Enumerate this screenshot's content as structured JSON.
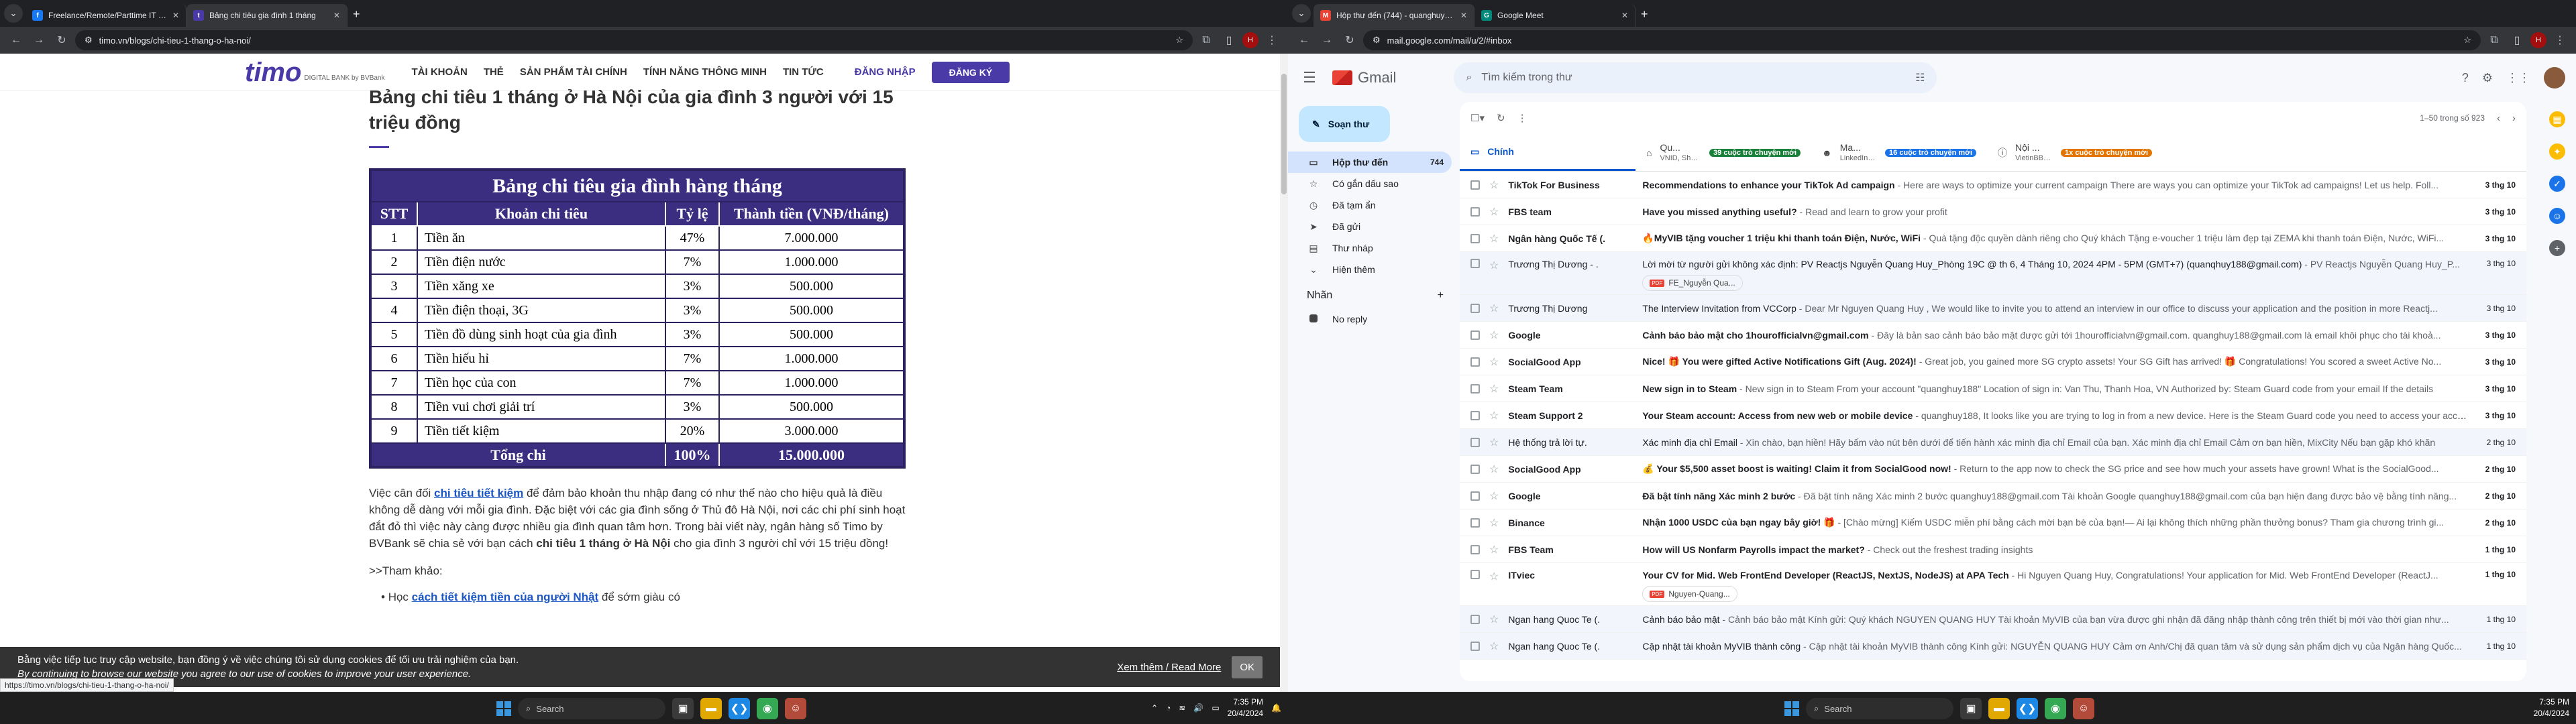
{
  "left": {
    "tabs": [
      {
        "title": "Freelance/Remote/Parttime IT Jobs",
        "favicon": "f"
      },
      {
        "title": "Bảng chi tiêu gia đình 1 tháng",
        "favicon": "t"
      }
    ],
    "url": "timo.vn/blogs/chi-tieu-1-thang-o-ha-noi/",
    "nav": {
      "brand": "timo",
      "brand_sub": "DIGITAL BANK by BVBank",
      "items": [
        "TÀI KHOẢN",
        "THẺ",
        "SẢN PHẨM TÀI CHÍNH",
        "TÍNH NĂNG THÔNG MINH",
        "TIN TỨC"
      ],
      "login": "ĐĂNG NHẬP",
      "signup": "ĐĂNG KÝ"
    },
    "article": {
      "title": "Bảng chi tiêu 1 tháng ở Hà Nội của gia đình 3 người với 15 triệu đồng",
      "table": {
        "caption": "Bảng chi tiêu gia đình hàng tháng",
        "headers": [
          "STT",
          "Khoản chi tiêu",
          "Tỷ lệ",
          "Thành tiền (VNĐ/tháng)"
        ],
        "rows": [
          [
            "1",
            "Tiền ăn",
            "47%",
            "7.000.000"
          ],
          [
            "2",
            "Tiền điện nước",
            "7%",
            "1.000.000"
          ],
          [
            "3",
            "Tiền xăng xe",
            "3%",
            "500.000"
          ],
          [
            "4",
            "Tiền điện thoại, 3G",
            "3%",
            "500.000"
          ],
          [
            "5",
            "Tiền đồ dùng sinh hoạt của gia đình",
            "3%",
            "500.000"
          ],
          [
            "6",
            "Tiền hiếu hỉ",
            "7%",
            "1.000.000"
          ],
          [
            "7",
            "Tiền học của con",
            "7%",
            "1.000.000"
          ],
          [
            "8",
            "Tiền vui chơi giải trí",
            "3%",
            "500.000"
          ],
          [
            "9",
            "Tiền tiết kiệm",
            "20%",
            "3.000.000"
          ]
        ],
        "total_label": "Tổng chi",
        "total_ratio": "100%",
        "total_amount": "15.000.000"
      },
      "p1_before": "Việc cân đối ",
      "p1_link": "chi tiêu tiết kiệm",
      "p1_mid": " để đảm bảo khoản thu nhập đang có như thế nào cho hiệu quả là điều không dễ dàng với mỗi gia đình. Đặc biệt với các gia đình sống ở Thủ đô Hà Nội, nơi các chi phí sinh hoạt đắt đỏ thì việc này càng được nhiều gia đình quan tâm hơn. Trong bài viết này, ngân hàng số Timo by BVBank sẽ chia sẻ với bạn cách ",
      "p1_bold": "chi tiêu 1 tháng ở Hà Nội",
      "p1_after": " cho gia đình 3 người chỉ với 15 triệu đồng!",
      "p2": ">>Tham khảo:",
      "p3_before": "Học ",
      "p3_link": "cách tiết kiệm tiền của người Nhật",
      "p3_after": " để sớm giàu có"
    },
    "cookie": {
      "line1": "Bằng việc tiếp tục truy cập website, bạn đồng ý về việc chúng tôi sử dụng cookies để tối ưu trải nghiệm của bạn.",
      "line2": "By continuing to browse our website you agree to our use of cookies to improve your user experience.",
      "more": "Xem thêm / Read More",
      "ok": "OK"
    },
    "status_url": "https://timo.vn/blogs/chi-tieu-1-thang-o-ha-noi/",
    "taskbar": {
      "search": "Search",
      "time": "7:35 PM",
      "date": "20/4/2024"
    }
  },
  "right": {
    "tabs": [
      {
        "title": "Hộp thư đến (744) - quanghuy188@gmail.com",
        "favicon": "M"
      },
      {
        "title": "Google Meet",
        "favicon": "G"
      }
    ],
    "url": "mail.google.com/mail/u/2/#inbox",
    "gmail": {
      "brand": "Gmail",
      "search_placeholder": "Tìm kiếm trong thư",
      "compose": "Soạn thư",
      "nav": [
        {
          "label": "Hộp thư đến",
          "count": "744",
          "icon": "inbox-icon",
          "glyph": "▭"
        },
        {
          "label": "Có gắn dấu sao",
          "count": "",
          "icon": "star-icon",
          "glyph": "☆"
        },
        {
          "label": "Đã tạm ẩn",
          "count": "",
          "icon": "clock-icon",
          "glyph": "◷"
        },
        {
          "label": "Đã gửi",
          "count": "",
          "icon": "send-icon",
          "glyph": "➤"
        },
        {
          "label": "Thư nháp",
          "count": "",
          "icon": "draft-icon",
          "glyph": "▤"
        },
        {
          "label": "Hiện thêm",
          "count": "",
          "icon": "chevron-down-icon",
          "glyph": "⌄"
        }
      ],
      "labels_title": "Nhãn",
      "labels": [
        "No reply"
      ],
      "count_text": "1–50 trong số 923",
      "tabs": [
        {
          "label": "Chính",
          "sub": "",
          "badge": "",
          "badge_color": ""
        },
        {
          "label": "Qu...",
          "sub": "VNID, Shopee Affiliate VN, Sol...",
          "badge": "39 cuộc trò chuyện mới",
          "badge_color": "#188038"
        },
        {
          "label": "Ma...",
          "sub": "LinkedIn, snapgbgg on Instagr...",
          "badge": "16 cuộc trò chuyện mới",
          "badge_color": "#1a73e8"
        },
        {
          "label": "Nội ...",
          "sub": "VietinBBH.vn, Selection Guns...",
          "badge": "1x cuộc trò chuyện mới",
          "badge_color": "#e37400"
        }
      ],
      "mails": [
        {
          "from": "TikTok For Business",
          "subject": "Recommendations to enhance your TikTok Ad campaign",
          "snippet": "Here are ways to optimize your current campaign There are ways you can optimize your TikTok ad campaigns! Let us help. Foll...",
          "date": "3 thg 10",
          "read": false,
          "attachment": ""
        },
        {
          "from": "FBS team",
          "subject": "Have you missed anything useful?",
          "snippet": "Read and learn to grow your profit",
          "date": "3 thg 10",
          "read": false,
          "attachment": ""
        },
        {
          "from": "Ngân hàng Quốc Tế (.",
          "subject": "🔥MyVIB tặng voucher 1 triệu khi thanh toán Điện, Nước, WiFi",
          "snippet": "Quà tặng độc quyền dành riêng cho Quý khách Tặng e-voucher 1 triệu làm đẹp tại ZEMA khi thanh toán Điện, Nước, WiFi...",
          "date": "3 thg 10",
          "read": false,
          "attachment": ""
        },
        {
          "from": "Trương Thị Dương - .",
          "subject": "Lời mời từ người gửi không xác định: PV Reactjs Nguyễn Quang Huy_Phòng 19C @ th 6, 4 Tháng 10, 2024 4PM - 5PM (GMT+7) (quanqhuy188@gmail.com)",
          "snippet": "PV Reactjs Nguyễn Quang Huy_P...",
          "date": "3 thg 10",
          "read": true,
          "attachment": "FE_Nguyễn Qua..."
        },
        {
          "from": "Trương Thị Dương",
          "subject": "The Interview Invitation from VCCorp",
          "snippet": "Dear Mr Nguyen Quang Huy , We would like to invite you to attend an interview in our office to discuss your application and the position in more Reactj...",
          "date": "3 thg 10",
          "read": true,
          "attachment": ""
        },
        {
          "from": "Google",
          "subject": "Cảnh báo bảo mật cho 1hourofficialvn@gmail.com",
          "snippet": "Đây là bản sao cảnh báo bảo mật được gửi tới 1hourofficialvn@gmail.com. quanghuy188@gmail.com là email khôi phục cho tài khoả...",
          "date": "3 thg 10",
          "read": false,
          "attachment": ""
        },
        {
          "from": "SocialGood App",
          "subject": "Nice! 🎁 You were gifted Active Notifications Gift (Aug. 2024)!",
          "snippet": "Great job, you gained more SG crypto assets! Your SG Gift has arrived! 🎁 Congratulations! You scored a sweet Active No...",
          "date": "3 thg 10",
          "read": false,
          "attachment": ""
        },
        {
          "from": "Steam Team",
          "subject": "New sign in to Steam",
          "snippet": "New sign in to Steam From your account \"quanghuy188\" Location of sign in: Van Thu, Thanh Hoa, VN Authorized by: Steam Guard code from your email If the details",
          "date": "3 thg 10",
          "read": false,
          "attachment": ""
        },
        {
          "from": "Steam Support 2",
          "subject": "Your Steam account: Access from new web or mobile device",
          "snippet": "quanghuy188, It looks like you are trying to log in from a new device. Here is the Steam Guard code you need to access your acco...",
          "date": "3 thg 10",
          "read": false,
          "attachment": ""
        },
        {
          "from": "Hệ thống trả lời tự.",
          "subject": "Xác minh địa chỉ Email",
          "snippet": "Xin chào, bạn hiền! Hãy bấm vào nút bên dưới để tiến hành xác minh địa chỉ Email của bạn. Xác minh địa chỉ Email Cảm ơn bạn hiền, MixCity Nếu bạn gặp khó khăn",
          "date": "2 thg 10",
          "read": true,
          "attachment": ""
        },
        {
          "from": "SocialGood App",
          "subject": "💰 Your $5,500 asset boost is waiting! Claim it from SocialGood now!",
          "snippet": "Return to the app now to check the SG price and see how much your assets have grown! What is the SocialGood...",
          "date": "2 thg 10",
          "read": false,
          "attachment": ""
        },
        {
          "from": "Google",
          "subject": "Đã bật tính năng Xác minh 2 bước",
          "snippet": "Đã bật tính năng Xác minh 2 bước quanghuy188@gmail.com Tài khoản Google quanghuy188@gmail.com của bạn hiện đang được bảo vệ bằng tính năng...",
          "date": "2 thg 10",
          "read": false,
          "attachment": ""
        },
        {
          "from": "Binance",
          "subject": "Nhận 1000 USDC của bạn ngay bây giờ! 🎁",
          "snippet": "[Chào mừng] Kiếm USDC miễn phí bằng cách mời bạn bè của bạn!— Ai lại không thích những phần thưởng bonus? Tham gia chương trình gi...",
          "date": "2 thg 10",
          "read": false,
          "attachment": ""
        },
        {
          "from": "FBS Team",
          "subject": "How will US Nonfarm Payrolls impact the market?",
          "snippet": "Check out the freshest trading insights",
          "date": "1 thg 10",
          "read": false,
          "attachment": ""
        },
        {
          "from": "ITviec",
          "subject": "Your CV for Mid. Web FrontEnd Developer (ReactJS, NextJS, NodeJS) at APA Tech",
          "snippet": "Hi Nguyen Quang Huy, Congratulations! Your application for Mid. Web FrontEnd Developer (ReactJ...",
          "date": "1 thg 10",
          "read": false,
          "attachment": "Nguyen-Quang..."
        },
        {
          "from": "Ngan hang Quoc Te (.",
          "subject": "Cảnh báo bảo mật",
          "snippet": "Cảnh báo bảo mật Kính gửi: Quý khách NGUYEN QUANG HUY Tài khoản MyVIB của bạn vừa được ghi nhận đã đăng nhập thành công trên thiết bị mới vào thời gian như...",
          "date": "1 thg 10",
          "read": true,
          "attachment": ""
        },
        {
          "from": "Ngan hang Quoc Te (.",
          "subject": "Cập nhật tài khoản MyVIB thành công",
          "snippet": "Cập nhật tài khoản MyVIB thành công Kính gửi: NGUYỄN QUANG HUY Cảm ơn Anh/Chị đã quan tâm và sử dụng sản phẩm dịch vụ của Ngân hàng Quốc...",
          "date": "1 thg 10",
          "read": true,
          "attachment": ""
        }
      ]
    },
    "taskbar": {
      "search": "Search",
      "time": "7:35 PM",
      "date": "20/4/2024"
    }
  }
}
